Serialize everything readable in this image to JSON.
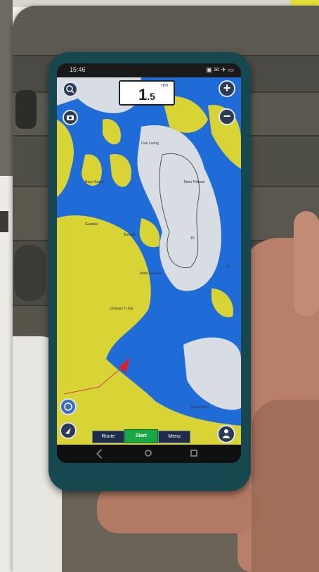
{
  "phone": {
    "status_time": "15:46",
    "status_icons": "▣ ✉ ✈ ▭",
    "zoom_label": "nm",
    "zoom_value_main": "1",
    "zoom_value_decimal": ".5",
    "buttons": {
      "zoom_in": "+",
      "zoom_out": "−",
      "search_icon": "search-icon",
      "camera_icon": "camera-icon",
      "compass_icon": "compass-icon",
      "gps_icon": "navigation-arrow-icon",
      "person_icon": "person-icon"
    },
    "bottom_tabs": [
      "Route",
      "Start",
      "Menu"
    ],
    "map_labels": {
      "label_1": "Tamo\nPalmas",
      "label_2": "Bayo\nGama",
      "label_3": "Arlito\nDa Lima",
      "label_4": "Chalopo\nTr Dai",
      "label_5": "Guolo\nBano",
      "label_6": "Gurabal",
      "label_7": "Bonado",
      "label_8": "Gao\nLuong",
      "depth_1": "15",
      "depth_2": "12"
    },
    "colors": {
      "land": "#d8d436",
      "deep_water": "#1f6cd8",
      "shallow_water": "#d8dde4",
      "frame": "#17484f",
      "start_button": "#1aa845"
    }
  }
}
